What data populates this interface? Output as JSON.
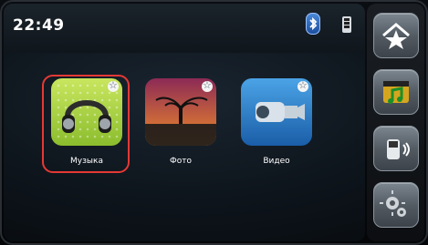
{
  "status": {
    "time": "22:49",
    "icons": [
      "bluetooth-icon",
      "signal-icon"
    ]
  },
  "tiles": [
    {
      "label": "Музыка",
      "icon": "headphones-icon",
      "selected": true
    },
    {
      "label": "Фото",
      "icon": "sunset-tree-icon",
      "selected": false
    },
    {
      "label": "Видео",
      "icon": "camcorder-icon",
      "selected": false
    }
  ],
  "sidebar": [
    {
      "icon": "home-star-icon"
    },
    {
      "icon": "media-clapper-note-icon"
    },
    {
      "icon": "phone-signal-icon"
    },
    {
      "icon": "settings-gears-icon"
    }
  ],
  "colors": {
    "selection": "#e53935",
    "accent_blue": "#1c4f9f"
  }
}
